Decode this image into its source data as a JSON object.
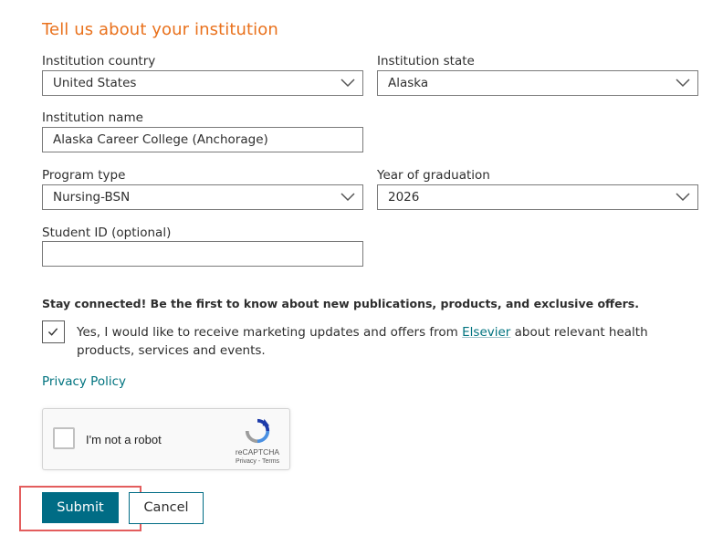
{
  "form": {
    "heading": "Tell us about your institution",
    "country": {
      "label": "Institution country",
      "value": "United States"
    },
    "state": {
      "label": "Institution state",
      "value": "Alaska"
    },
    "institution_name": {
      "label": "Institution name",
      "value": "Alaska Career College (Anchorage)"
    },
    "program_type": {
      "label": "Program type",
      "value": "Nursing-BSN"
    },
    "graduation_year": {
      "label": "Year of graduation",
      "value": "2026"
    },
    "student_id": {
      "label": "Student ID (optional)",
      "value": ""
    }
  },
  "marketing": {
    "headline": "Stay connected! Be the first to know about new publications, products, and exclusive offers.",
    "consent_prefix": "Yes, I would like to receive marketing updates and offers from ",
    "consent_link": "Elsevier",
    "consent_suffix": " about relevant health products, services and events.",
    "checked": true
  },
  "privacy_link": "Privacy Policy",
  "captcha": {
    "label": "I'm not a robot",
    "brand": "reCAPTCHA",
    "terms": "Privacy - Terms"
  },
  "buttons": {
    "submit": "Submit",
    "cancel": "Cancel"
  },
  "colors": {
    "heading": "#e9711c",
    "primary": "#006c85",
    "link": "#00737f",
    "highlight": "#e35d5d"
  }
}
